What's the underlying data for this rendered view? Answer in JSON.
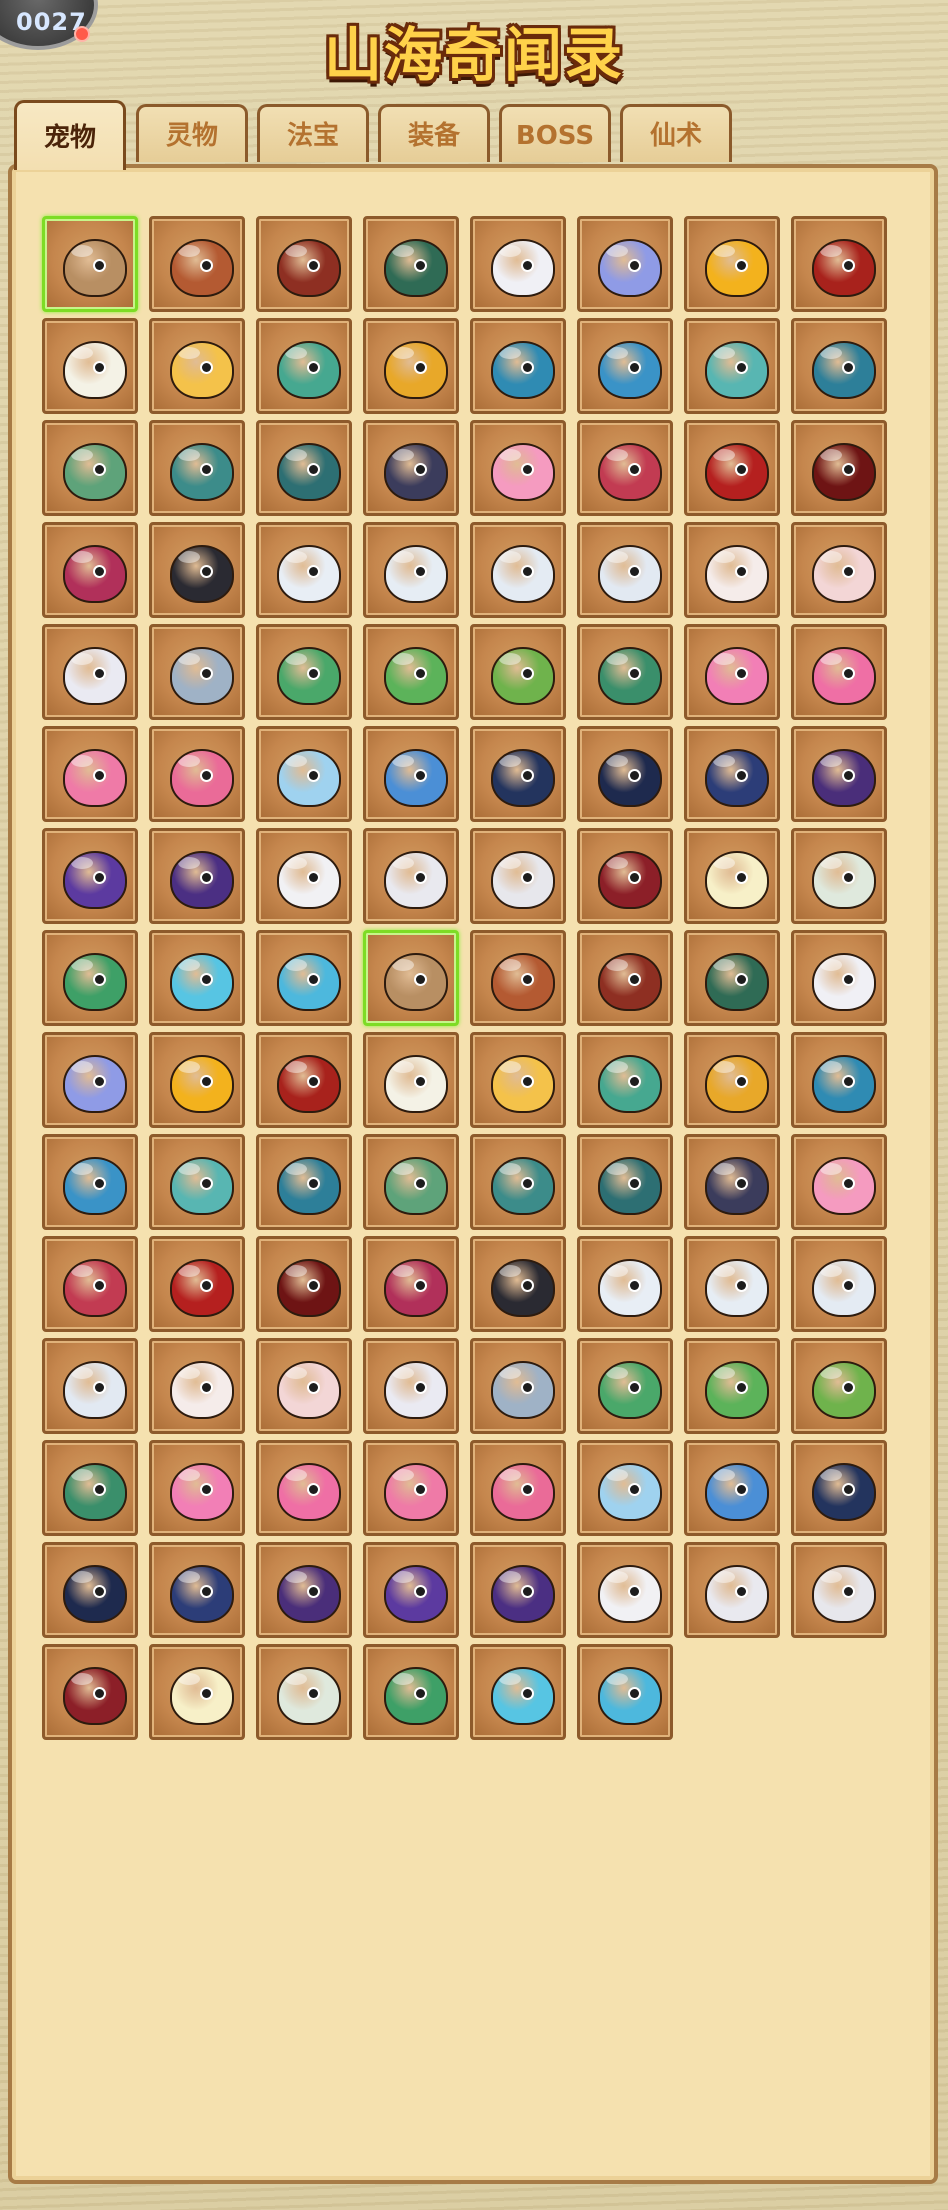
{
  "header": {
    "title": "山海奇闻录",
    "corner_counter": "0027",
    "notify_color": "#ff5a4a"
  },
  "tabs": [
    {
      "label": "宠物",
      "active": true
    },
    {
      "label": "灵物",
      "active": false
    },
    {
      "label": "法宝",
      "active": false
    },
    {
      "label": "装备",
      "active": false
    },
    {
      "label": "BOSS",
      "active": false
    },
    {
      "label": "仙术",
      "active": false
    }
  ],
  "pets": [
    {
      "icon": "monkey-icon",
      "color": "#b88f63",
      "selected": true
    },
    {
      "icon": "monkey-icon",
      "color": "#b45a32"
    },
    {
      "icon": "monkey-warrior-icon",
      "color": "#8e2f22"
    },
    {
      "icon": "monkey-king-icon",
      "color": "#2f6b55"
    },
    {
      "icon": "white-spirit-icon",
      "color": "#f0f0f5"
    },
    {
      "icon": "unicorn-icon",
      "color": "#8f9be6"
    },
    {
      "icon": "golden-helmet-icon",
      "color": "#f3b21d"
    },
    {
      "icon": "crimson-helmet-icon",
      "color": "#a8221c"
    },
    {
      "icon": "white-bird-icon",
      "color": "#f4f2e6"
    },
    {
      "icon": "yellow-bird-icon",
      "color": "#f4c24a"
    },
    {
      "icon": "jade-bird-icon",
      "color": "#46a890"
    },
    {
      "icon": "gold-armor-bird-icon",
      "color": "#e8a829"
    },
    {
      "icon": "teal-fish-icon",
      "color": "#2f8bb3"
    },
    {
      "icon": "blue-fish-icon",
      "color": "#3a93c7"
    },
    {
      "icon": "horned-fish-icon",
      "color": "#58b6b2"
    },
    {
      "icon": "armored-fish-icon",
      "color": "#2d7f99"
    },
    {
      "icon": "green-dragon-icon",
      "color": "#5ea37a"
    },
    {
      "icon": "teal-dragon-icon",
      "color": "#3c8c8a"
    },
    {
      "icon": "horned-dragon-icon",
      "color": "#2d6f73"
    },
    {
      "icon": "demon-dragon-icon",
      "color": "#3b3c5c"
    },
    {
      "icon": "pink-chick-icon",
      "color": "#f59bc0"
    },
    {
      "icon": "red-bird-icon",
      "color": "#c23b52"
    },
    {
      "icon": "fire-bird-icon",
      "color": "#b5201f"
    },
    {
      "icon": "dark-phoenix-icon",
      "color": "#6e1414"
    },
    {
      "icon": "magenta-wolf-icon",
      "color": "#b1305a"
    },
    {
      "icon": "black-wolf-icon",
      "color": "#2a2a32"
    },
    {
      "icon": "sheep-icon",
      "color": "#e8eef5"
    },
    {
      "icon": "sheep-icon",
      "color": "#e6edf4"
    },
    {
      "icon": "sheep-icon",
      "color": "#e4ebf3"
    },
    {
      "icon": "sheep-icon",
      "color": "#e2e9f2"
    },
    {
      "icon": "white-rabbit-icon",
      "color": "#f5ecea"
    },
    {
      "icon": "pink-rabbit-icon",
      "color": "#f3d6d6"
    },
    {
      "icon": "armored-rabbit-icon",
      "color": "#eaeaf2"
    },
    {
      "icon": "steel-rabbit-icon",
      "color": "#9fb2c6"
    },
    {
      "icon": "green-parrot-icon",
      "color": "#4aa86a"
    },
    {
      "icon": "green-parrot-icon",
      "color": "#5cb35a"
    },
    {
      "icon": "feather-parrot-icon",
      "color": "#6fb34c"
    },
    {
      "icon": "peacock-icon",
      "color": "#3a8f6b"
    },
    {
      "icon": "pink-fairy-icon",
      "color": "#f27fb6"
    },
    {
      "icon": "pink-fairy-icon",
      "color": "#ef6fa5"
    },
    {
      "icon": "mermaid-icon",
      "color": "#ef7aa7"
    },
    {
      "icon": "mermaid-icon",
      "color": "#ea6b98"
    },
    {
      "icon": "blue-wisp-icon",
      "color": "#9fd2ef"
    },
    {
      "icon": "blue-unicorn-icon",
      "color": "#4b8fd6"
    },
    {
      "icon": "navy-knight-icon",
      "color": "#23345e"
    },
    {
      "icon": "navy-unicorn-icon",
      "color": "#1e2a4e"
    },
    {
      "icon": "navy-helm-icon",
      "color": "#2c3d78"
    },
    {
      "icon": "purple-helm-icon",
      "color": "#4a2e7a"
    },
    {
      "icon": "purple-horse-icon",
      "color": "#5c3aa0"
    },
    {
      "icon": "purple-armor-icon",
      "color": "#4b2f83"
    },
    {
      "icon": "white-ghost-icon",
      "color": "#f1f1f4"
    },
    {
      "icon": "masked-ghost-icon",
      "color": "#e9e9ef"
    },
    {
      "icon": "horned-mask-icon",
      "color": "#e7e7ec"
    },
    {
      "icon": "crimson-mask-icon",
      "color": "#8c1f28"
    },
    {
      "icon": "yellow-chick-icon",
      "color": "#f7f0c8"
    },
    {
      "icon": "eagle-icon",
      "color": "#dfe9dd"
    },
    {
      "icon": "green-eagle-icon",
      "color": "#3ea067"
    },
    {
      "icon": "cyan-hair-icon",
      "color": "#57c5e3"
    },
    {
      "icon": "cyan-hair-icon",
      "color": "#4db8dd"
    },
    {
      "icon": "monkey-icon",
      "color": "#b88f63",
      "selected": true
    },
    {
      "icon": "monkey-icon",
      "color": "#b45a32"
    },
    {
      "icon": "monkey-warrior-icon",
      "color": "#8e2f22"
    },
    {
      "icon": "monkey-king-icon",
      "color": "#2f6b55"
    },
    {
      "icon": "white-spirit-icon",
      "color": "#f0f0f5"
    },
    {
      "icon": "unicorn-icon",
      "color": "#8f9be6"
    },
    {
      "icon": "golden-helmet-icon",
      "color": "#f3b21d"
    },
    {
      "icon": "crimson-helmet-icon",
      "color": "#a8221c"
    },
    {
      "icon": "white-bird-icon",
      "color": "#f4f2e6"
    },
    {
      "icon": "yellow-bird-icon",
      "color": "#f4c24a"
    },
    {
      "icon": "jade-bird-icon",
      "color": "#46a890"
    },
    {
      "icon": "gold-armor-bird-icon",
      "color": "#e8a829"
    },
    {
      "icon": "teal-fish-icon",
      "color": "#2f8bb3"
    },
    {
      "icon": "blue-fish-icon",
      "color": "#3a93c7"
    },
    {
      "icon": "horned-fish-icon",
      "color": "#58b6b2"
    },
    {
      "icon": "armored-fish-icon",
      "color": "#2d7f99"
    },
    {
      "icon": "green-dragon-icon",
      "color": "#5ea37a"
    },
    {
      "icon": "teal-dragon-icon",
      "color": "#3c8c8a"
    },
    {
      "icon": "horned-dragon-icon",
      "color": "#2d6f73"
    },
    {
      "icon": "demon-dragon-icon",
      "color": "#3b3c5c"
    },
    {
      "icon": "pink-chick-icon",
      "color": "#f59bc0"
    },
    {
      "icon": "red-bird-icon",
      "color": "#c23b52"
    },
    {
      "icon": "fire-bird-icon",
      "color": "#b5201f"
    },
    {
      "icon": "dark-phoenix-icon",
      "color": "#6e1414"
    },
    {
      "icon": "magenta-wolf-icon",
      "color": "#b1305a"
    },
    {
      "icon": "black-wolf-icon",
      "color": "#2a2a32"
    },
    {
      "icon": "sheep-icon",
      "color": "#e8eef5"
    },
    {
      "icon": "sheep-icon",
      "color": "#e6edf4"
    },
    {
      "icon": "sheep-icon",
      "color": "#e4ebf3"
    },
    {
      "icon": "sheep-icon",
      "color": "#e2e9f2"
    },
    {
      "icon": "white-rabbit-icon",
      "color": "#f5ecea"
    },
    {
      "icon": "pink-rabbit-icon",
      "color": "#f3d6d6"
    },
    {
      "icon": "armored-rabbit-icon",
      "color": "#eaeaf2"
    },
    {
      "icon": "steel-rabbit-icon",
      "color": "#9fb2c6"
    },
    {
      "icon": "green-parrot-icon",
      "color": "#4aa86a"
    },
    {
      "icon": "green-parrot-icon",
      "color": "#5cb35a"
    },
    {
      "icon": "feather-parrot-icon",
      "color": "#6fb34c"
    },
    {
      "icon": "peacock-icon",
      "color": "#3a8f6b"
    },
    {
      "icon": "pink-fairy-icon",
      "color": "#f27fb6"
    },
    {
      "icon": "pink-fairy-icon",
      "color": "#ef6fa5"
    },
    {
      "icon": "mermaid-icon",
      "color": "#ef7aa7"
    },
    {
      "icon": "mermaid-icon",
      "color": "#ea6b98"
    },
    {
      "icon": "blue-wisp-icon",
      "color": "#9fd2ef"
    },
    {
      "icon": "blue-unicorn-icon",
      "color": "#4b8fd6"
    },
    {
      "icon": "navy-knight-icon",
      "color": "#23345e"
    },
    {
      "icon": "navy-unicorn-icon",
      "color": "#1e2a4e"
    },
    {
      "icon": "navy-helm-icon",
      "color": "#2c3d78"
    },
    {
      "icon": "purple-helm-icon",
      "color": "#4a2e7a"
    },
    {
      "icon": "purple-horse-icon",
      "color": "#5c3aa0"
    },
    {
      "icon": "purple-armor-icon",
      "color": "#4b2f83"
    },
    {
      "icon": "white-ghost-icon",
      "color": "#f1f1f4"
    },
    {
      "icon": "masked-ghost-icon",
      "color": "#e9e9ef"
    },
    {
      "icon": "horned-mask-icon",
      "color": "#e7e7ec"
    },
    {
      "icon": "crimson-mask-icon",
      "color": "#8c1f28"
    },
    {
      "icon": "yellow-chick-icon",
      "color": "#f7f0c8"
    },
    {
      "icon": "eagle-icon",
      "color": "#dfe9dd"
    },
    {
      "icon": "green-eagle-icon",
      "color": "#3ea067"
    },
    {
      "icon": "cyan-hair-icon",
      "color": "#57c5e3"
    },
    {
      "icon": "cyan-hair-icon",
      "color": "#4db8dd"
    }
  ]
}
